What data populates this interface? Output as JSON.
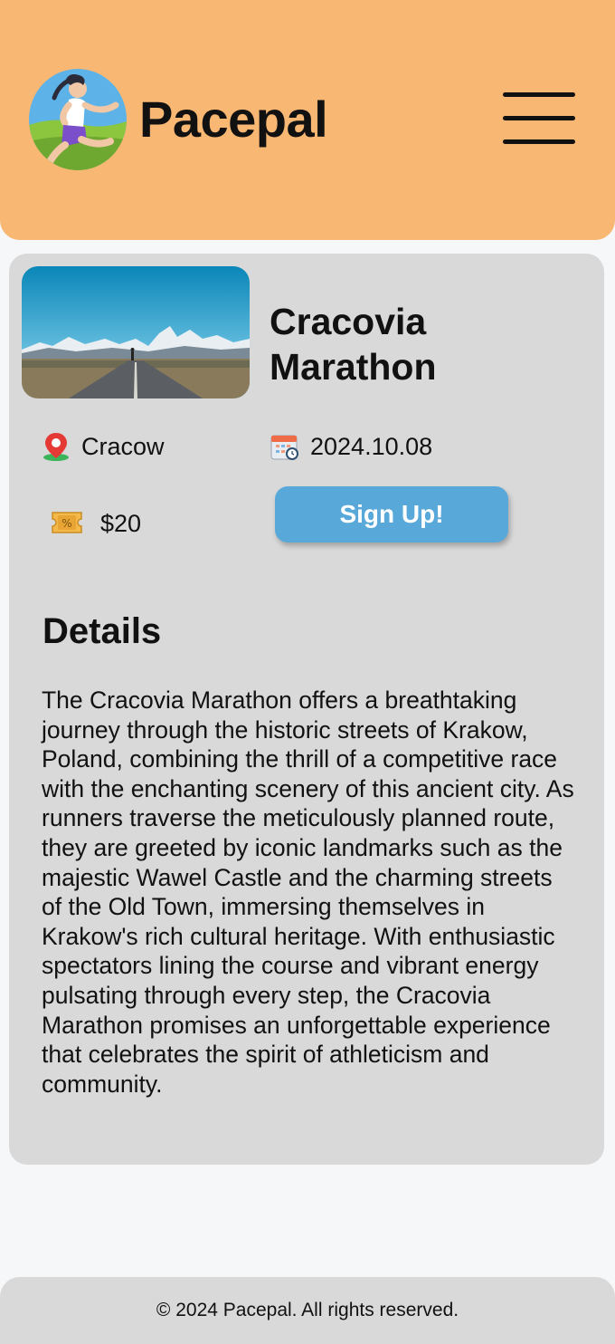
{
  "header": {
    "brand": "Pacepal",
    "logo_icon": "runner-icon",
    "menu_icon": "hamburger-menu-icon",
    "background_color": "#f8b772"
  },
  "event": {
    "title": "Cracovia Marathon",
    "location": "Cracow",
    "location_icon": "map-pin-icon",
    "date": "2024.10.08",
    "date_icon": "calendar-clock-icon",
    "price": "$20",
    "price_icon": "ticket-icon",
    "signup_label": "Sign Up!",
    "accent_color": "#59a8da"
  },
  "details": {
    "heading": "Details",
    "text": "The Cracovia Marathon offers a breathtaking journey through the historic streets of Krakow, Poland, combining the thrill of a competitive race with the enchanting scenery of this ancient city. As runners traverse the meticulously planned route, they are greeted by iconic landmarks such as the majestic Wawel Castle and the charming streets of the Old Town, immersing themselves in Krakow's rich cultural heritage. With enthusiastic spectators lining the course and vibrant energy pulsating through every step, the Cracovia Marathon promises an unforgettable experience that celebrates the spirit of athleticism and community."
  },
  "footer": {
    "copyright": "© 2024 Pacepal. All rights reserved."
  }
}
